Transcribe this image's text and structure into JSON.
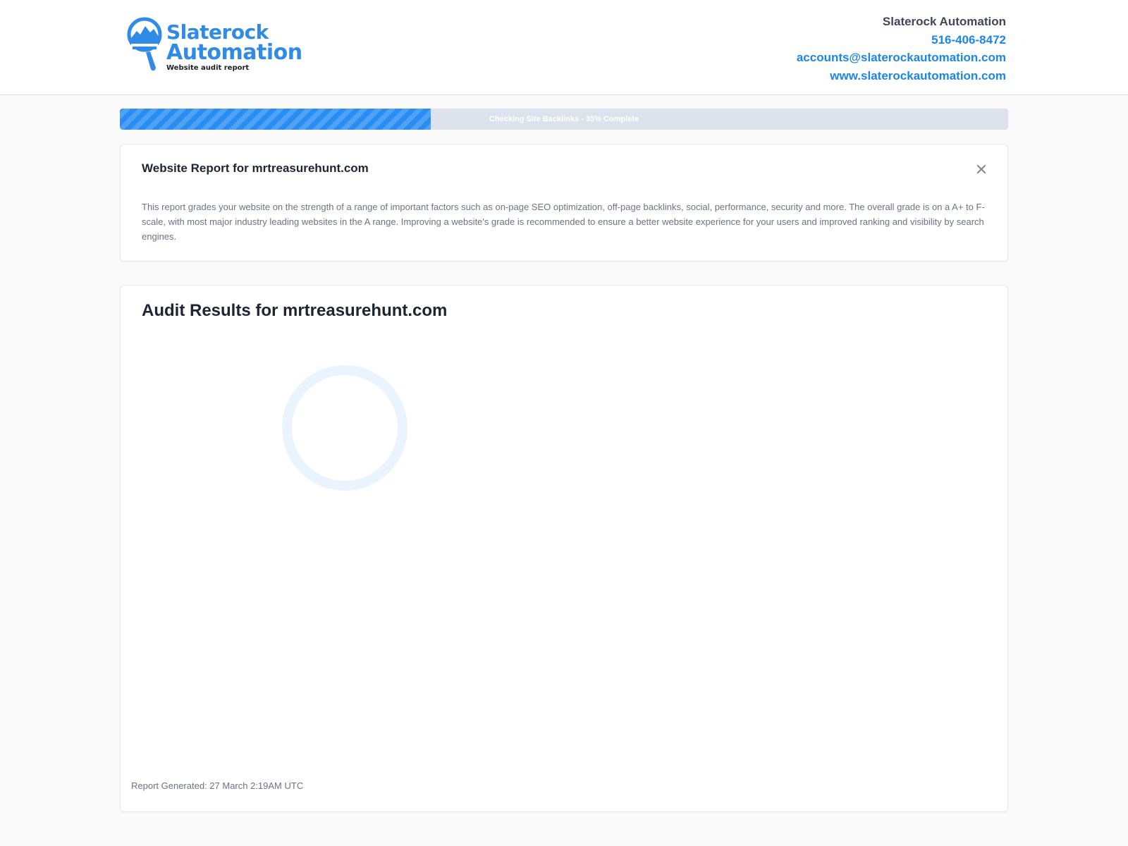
{
  "brand": {
    "logo_line1": "Slaterock",
    "logo_line2": "Automation",
    "logo_tagline": "Website audit report",
    "accent_color": "#2f8be6"
  },
  "contact": {
    "company": "Slaterock Automation",
    "phone": "516-406-8472",
    "email": "accounts@slaterockautomation.com",
    "website": "www.slaterockautomation.com"
  },
  "progress": {
    "label": "Checking Site Backlinks - 35% Complete",
    "fraction": 0.35,
    "fill_color": "#2a8df2"
  },
  "report": {
    "title": "Website Report for mrtreasurehunt.com",
    "description": "This report grades your website on the strength of a range of important factors such as on-page SEO optimization, off-page backlinks, social, performance, security and more. The overall grade is on a A+ to F- scale, with most major industry leading websites in the A range. Improving a website's grade is recommended to ensure a better website experience for your users and improved ranking and visibility by search engines.",
    "close_icon": "close-icon"
  },
  "audit": {
    "title": "Audit Results for mrtreasurehunt.com",
    "spinner_icon": "loading-spinner-icon",
    "generated": "Report Generated: 27 March 2:19AM UTC"
  }
}
